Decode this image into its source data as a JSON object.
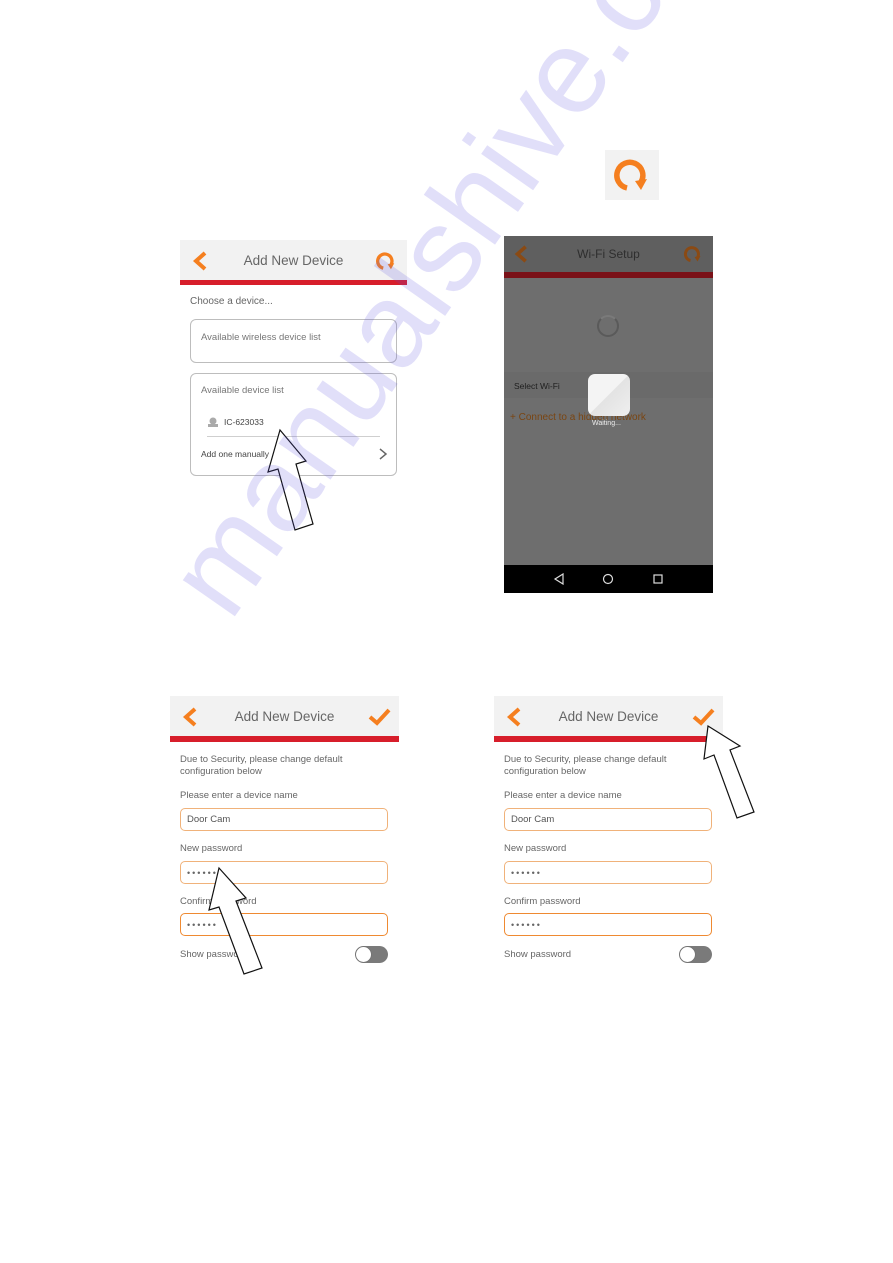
{
  "inline_icon": "refresh-icon",
  "colors": {
    "accent_orange": "#f57f1f",
    "header_red": "#d71e2b",
    "header_bg": "#f2f2f2",
    "field_border": "#f0b27a"
  },
  "screen1": {
    "title": "Add New Device",
    "left_icon": "back-chevron-icon",
    "right_icon": "refresh-icon",
    "prompt": "Choose a device...",
    "wireless_list_title": "Available wireless device list",
    "device_list_title": "Available device list",
    "devices": [
      {
        "icon": "camera-icon",
        "name": "IC-623033"
      }
    ],
    "add_manually": "Add one manually"
  },
  "screen2": {
    "title": "Wi-Fi Setup",
    "left_icon": "back-chevron-icon",
    "right_icon": "refresh-icon",
    "section_label": "Select Wi-Fi",
    "hidden_network_link": "+ Connect to a hidden network",
    "loading_text": "Waiting...",
    "nav_buttons": [
      "back-triangle-icon",
      "home-circle-icon",
      "recents-square-icon"
    ]
  },
  "screen3": {
    "title": "Add New Device",
    "left_icon": "back-chevron-icon",
    "right_icon": "checkmark-icon",
    "intro": "Due to Security, please change default configuration below",
    "device_name_label": "Please enter a device name",
    "device_name_value": "Door Cam",
    "new_password_label": "New password",
    "new_password_value": "••••••",
    "confirm_password_label": "Confirm password",
    "confirm_password_value": "••••••",
    "show_password_label": "Show password",
    "show_password_on": false
  },
  "screen4": {
    "title": "Add New Device",
    "left_icon": "back-chevron-icon",
    "right_icon": "checkmark-icon",
    "intro": "Due to Security, please change default configuration below",
    "device_name_label": "Please enter a device name",
    "device_name_value": "Door Cam",
    "new_password_label": "New password",
    "new_password_value": "••••••",
    "confirm_password_label": "Confirm password",
    "confirm_password_value": "••••••",
    "show_password_label": "Show password",
    "show_password_on": false
  },
  "watermark": "manualshive.com"
}
